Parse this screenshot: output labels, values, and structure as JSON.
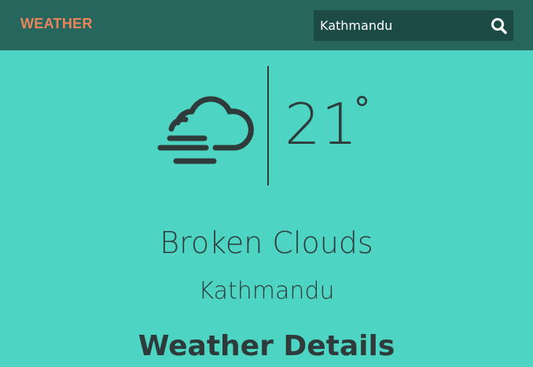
{
  "header": {
    "brand": "WEATHER",
    "search": {
      "value": "Kathmandu",
      "icon": "search-icon"
    }
  },
  "current": {
    "icon": "cloud-fog-icon",
    "temperature": "21",
    "degree_symbol": "°",
    "description": "Broken Clouds",
    "city": "Kathmandu"
  },
  "details": {
    "heading": "Weather Details"
  },
  "colors": {
    "background": "#4dd4c3",
    "navbar": "#26665c",
    "search_bg": "#1c4a44",
    "brand": "#e8855a",
    "text": "#2f3b3a"
  }
}
